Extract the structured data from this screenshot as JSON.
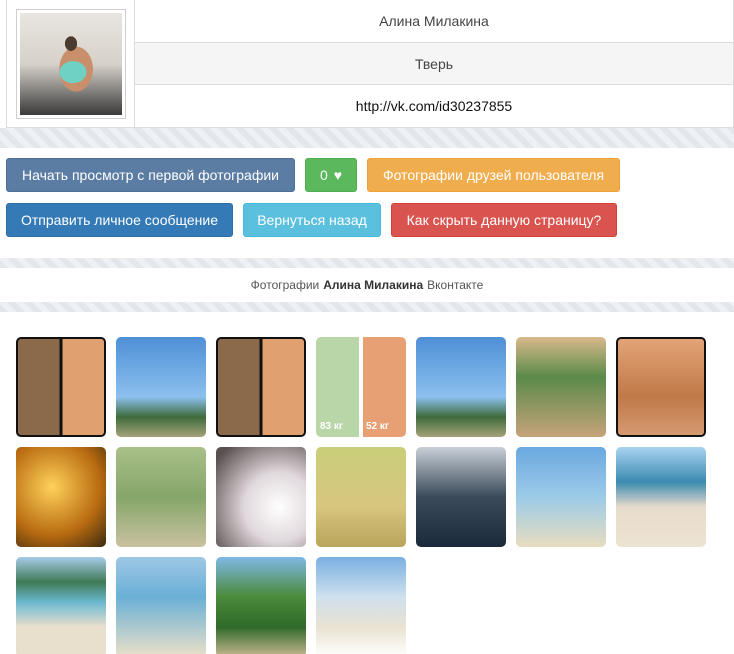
{
  "profile": {
    "name": "Алина Милакина",
    "city": "Тверь",
    "url": "http://vk.com/id30237855"
  },
  "buttons": {
    "start_view": "Начать просмотр с первой фотографии",
    "likes_count": "0",
    "friends_photos": "Фотографии друзей пользователя",
    "send_message": "Отправить личное сообщение",
    "go_back": "Вернуться назад",
    "hide_page": "Как скрыть данную страницу?"
  },
  "caption": {
    "prefix": "Фотографии",
    "name": "Алина Милакина",
    "suffix": "Вконтакте"
  },
  "gallery": {
    "thumb_labels": {
      "before": "83 кг",
      "after": "52 кг"
    }
  },
  "colors": {
    "primary": "#337ab7",
    "success": "#5cb85c",
    "warning": "#f0ad4e",
    "info": "#5bc0de",
    "danger": "#d9534f"
  },
  "icons": {
    "like": "heart-icon"
  }
}
